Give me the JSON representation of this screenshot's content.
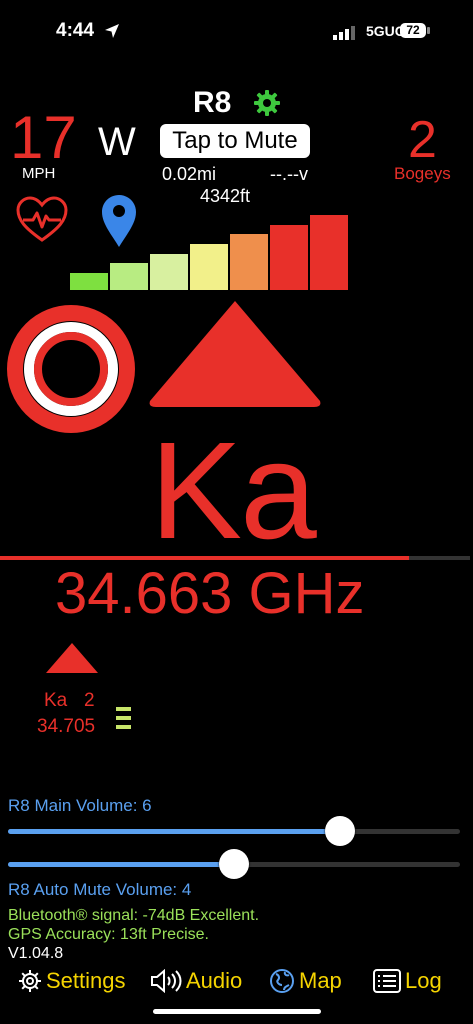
{
  "status_bar": {
    "time": "4:44",
    "network": "5GUC",
    "battery": "72"
  },
  "header": {
    "device": "R8",
    "mute_label": "Tap to Mute"
  },
  "gps": {
    "speed": "17",
    "speed_unit": "MPH",
    "heading": "W",
    "distance": "0.02mi",
    "voltage": "--.--v",
    "altitude": "4342ft"
  },
  "bogeys": {
    "count": "2",
    "label": "Bogeys"
  },
  "signal_strength": {
    "levels": 7,
    "colors": [
      "#7ee040",
      "#b8ec82",
      "#d8f0a0",
      "#f2f08a",
      "#ef8f4c",
      "#e8302a",
      "#e8302a"
    ]
  },
  "alert": {
    "band": "Ka",
    "frequency": "34.663 GHz",
    "strength_fraction": 0.87
  },
  "secondary_alert": {
    "band": "Ka",
    "count": "2",
    "frequency": "34.705",
    "strength_levels": 3
  },
  "volumes": {
    "main": {
      "label": "R8 Main Volume: 6",
      "level_fraction": 0.735
    },
    "auto_mute": {
      "label": "R8 Auto Mute Volume: 4",
      "level_fraction": 0.5
    }
  },
  "status": {
    "bluetooth": "Bluetooth® signal: -74dB Excellent.",
    "gps_accuracy": "GPS Accuracy: 13ft Precise.",
    "version": "V1.04.8"
  },
  "tabs": [
    {
      "label": "Settings",
      "icon": "gear-icon"
    },
    {
      "label": "Audio",
      "icon": "speaker-icon"
    },
    {
      "label": "Map",
      "icon": "globe-icon"
    },
    {
      "label": "Log",
      "icon": "list-icon"
    }
  ],
  "colors": {
    "accent_red": "#e8302a",
    "accent_blue": "#5aa0f0",
    "accent_yellow": "#f5d400",
    "accent_green": "#9be15a"
  }
}
